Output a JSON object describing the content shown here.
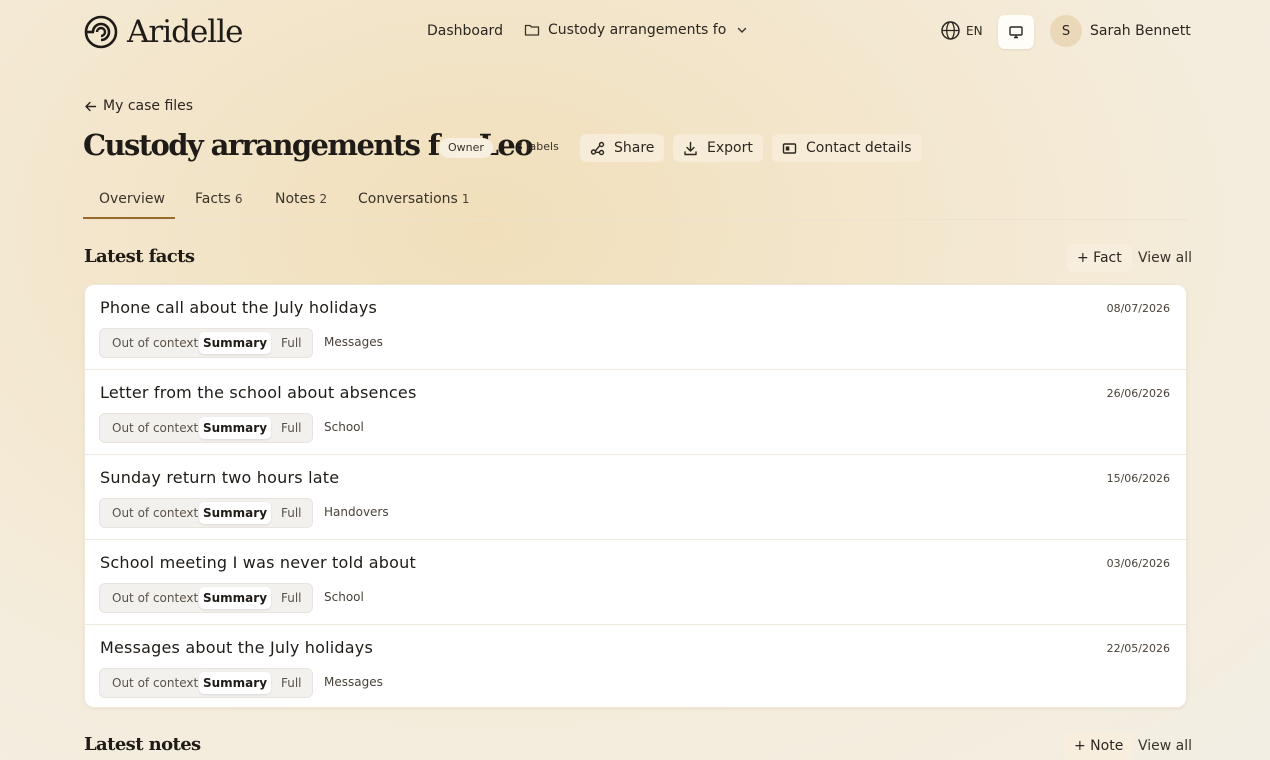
{
  "app": {
    "logo_text": "Aridelle"
  },
  "header": {
    "dashboard": "Dashboard",
    "case_selector": "Custody arrangements fo",
    "language": "EN",
    "avatar_initial": "S",
    "user_name": "Sarah Bennett"
  },
  "breadcrumb": {
    "back_label": "My case files"
  },
  "case": {
    "title": "Custody arrangements for Leo",
    "role_badge": "Owner",
    "labels": "3 labels",
    "actions": {
      "share": "Share",
      "export": "Export",
      "contact": "Contact details"
    }
  },
  "tabs": [
    {
      "label": "Overview",
      "count": ""
    },
    {
      "label": "Facts",
      "count": "6"
    },
    {
      "label": "Notes",
      "count": "2"
    },
    {
      "label": "Conversations",
      "count": "1"
    }
  ],
  "facts_section": {
    "title": "Latest facts",
    "add_label": "+ Fact",
    "view_all": "View all",
    "view_options": [
      "Out of context",
      "Summary",
      "Full"
    ],
    "selected_view": "Summary",
    "items": [
      {
        "title": "Phone call about the July holidays",
        "date": "08/07/2026",
        "tag": "Messages"
      },
      {
        "title": "Letter from the school about absences",
        "date": "26/06/2026",
        "tag": "School"
      },
      {
        "title": "Sunday return two hours late",
        "date": "15/06/2026",
        "tag": "Handovers"
      },
      {
        "title": "School meeting I was never told about",
        "date": "03/06/2026",
        "tag": "School"
      },
      {
        "title": "Messages about the July holidays",
        "date": "22/05/2026",
        "tag": "Messages"
      }
    ]
  },
  "notes_section": {
    "title": "Latest notes",
    "add_label": "+ Note",
    "view_all": "View all"
  },
  "colors": {
    "accent": "#9a6a2a",
    "card_bg": "#ffffff",
    "button_bg": "#f6ecd8"
  }
}
